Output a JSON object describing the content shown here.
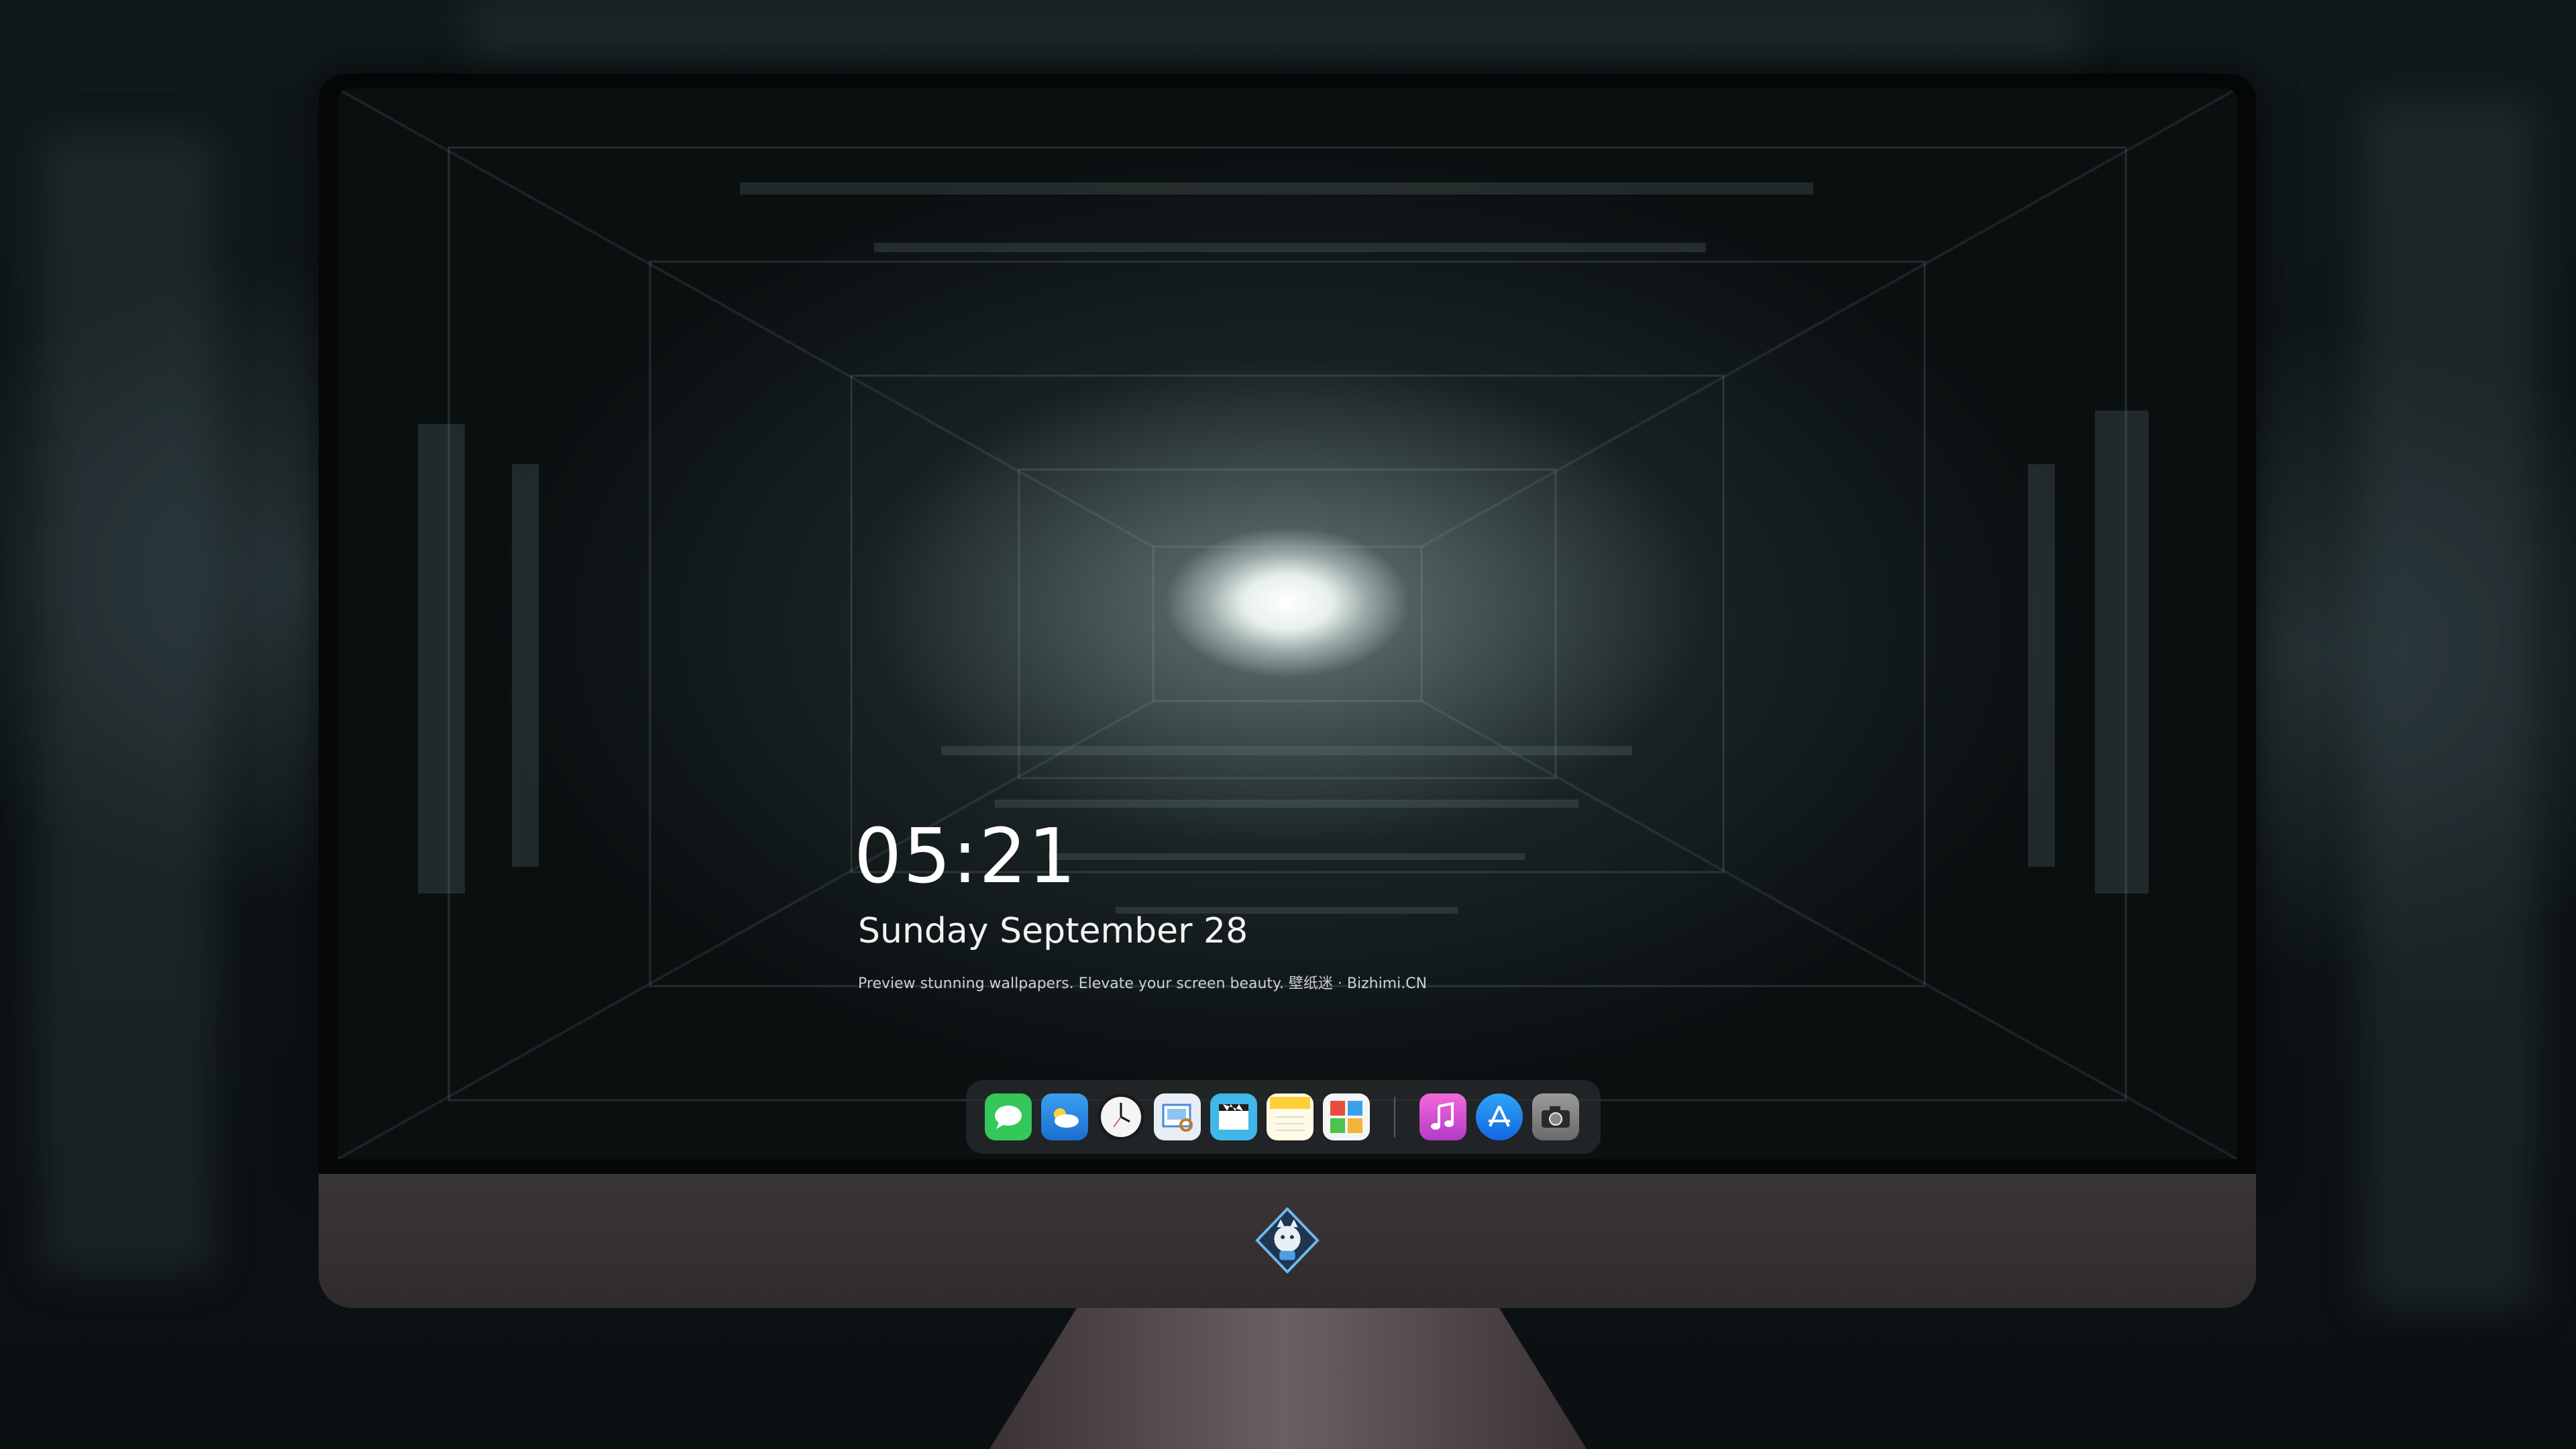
{
  "lock_screen": {
    "time": "05:21",
    "date": "Sunday September  28",
    "caption": "Preview stunning wallpapers. Elevate your screen beauty. 壁纸迷 · Bizhimi.CN"
  },
  "dock": {
    "apps": [
      {
        "name": "messages-icon",
        "color": "#34c759"
      },
      {
        "name": "weather-icon",
        "color": "#2f8fe8"
      },
      {
        "name": "clock-icon",
        "color": "#f2f2f2"
      },
      {
        "name": "preview-icon",
        "color": "#e8eef6"
      },
      {
        "name": "clips-icon",
        "color": "#3fb7e8"
      },
      {
        "name": "notes-icon",
        "color": "#ffd740"
      },
      {
        "name": "photo-booth-icon",
        "color": "#f5f5f5"
      },
      {
        "name": "music-icon",
        "color": "#d94fd6"
      },
      {
        "name": "app-store-icon",
        "color": "#1e88f0"
      },
      {
        "name": "camera-icon",
        "color": "#8c8c8c"
      }
    ]
  },
  "colors": {
    "chin": "#3a3638",
    "bezel": "#050707",
    "text": "#ffffff"
  }
}
